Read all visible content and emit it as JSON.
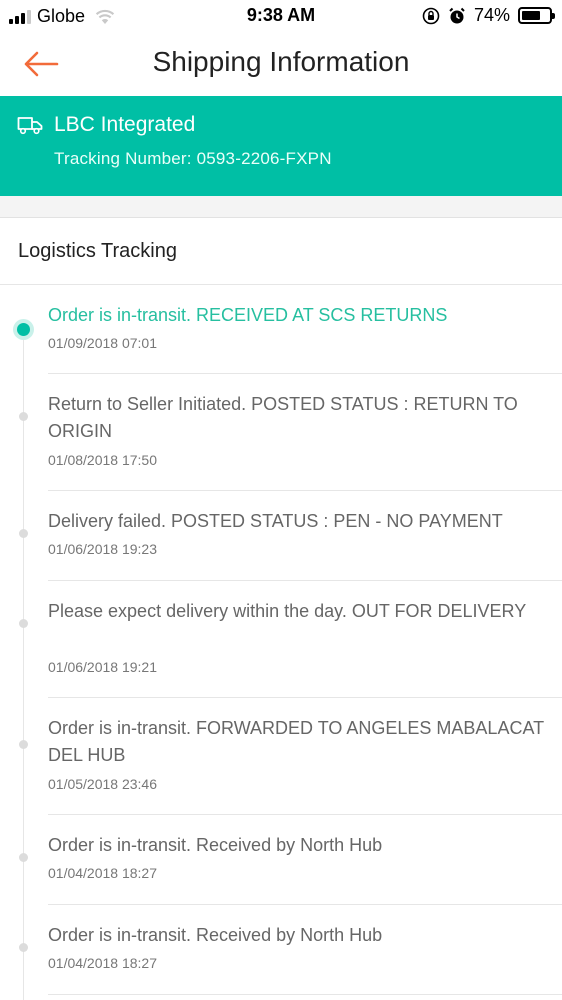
{
  "status_bar": {
    "carrier": "Globe",
    "time": "9:38 AM",
    "battery_percent": "74%",
    "battery_level": 0.74,
    "icons": [
      "signal-icon",
      "wifi-icon",
      "orientation-lock-icon",
      "alarm-icon",
      "battery-icon"
    ]
  },
  "nav": {
    "title": "Shipping Information",
    "back_icon": "arrow-left-icon",
    "accent_color": "#f26b3a"
  },
  "carrier_banner": {
    "name": "LBC Integrated",
    "tracking_number": "Tracking Number: 0593-2206-FXPN",
    "icon": "truck-icon",
    "background_color": "#00bfa5"
  },
  "tracking": {
    "title": "Logistics Tracking",
    "events": [
      {
        "description": "Order is in-transit. RECEIVED AT SCS RETURNS",
        "timestamp": "01/09/2018 07:01",
        "active": true
      },
      {
        "description": "Return to Seller Initiated. POSTED STATUS : RETURN TO ORIGIN",
        "timestamp": "01/08/2018 17:50",
        "active": false
      },
      {
        "description": "Delivery failed. POSTED STATUS : PEN - NO PAYMENT",
        "timestamp": "01/06/2018 19:23",
        "active": false
      },
      {
        "description": "Please expect delivery within the day. OUT FOR DELIVERY",
        "timestamp": "01/06/2018 19:21",
        "active": false
      },
      {
        "description": "Order is in-transit. FORWARDED TO ANGELES MABALACAT DEL HUB",
        "timestamp": "01/05/2018 23:46",
        "active": false
      },
      {
        "description": "Order is in-transit. Received by North Hub",
        "timestamp": "01/04/2018 18:27",
        "active": false
      },
      {
        "description": "Order is in-transit. Received by North Hub",
        "timestamp": "01/04/2018 18:27",
        "active": false
      }
    ]
  }
}
